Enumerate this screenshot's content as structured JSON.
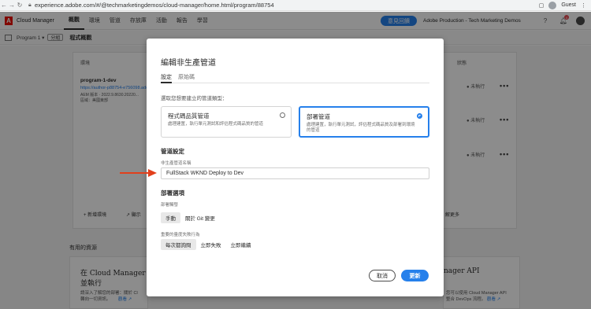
{
  "browser": {
    "url": "experience.adobe.com/#/@techmarketingdemos/cloud-manager/home.html/program/88754",
    "guest_label": "Guest",
    "menu_glyph": "⋮"
  },
  "header": {
    "app_name": "Cloud Manager",
    "nav": [
      "概觀",
      "環境",
      "管道",
      "存放庫",
      "活動",
      "報告",
      "學習"
    ],
    "cta_label": "意見回饋",
    "org_name": "Adobe Production - Tech Marketing Demos",
    "notification_count": "4"
  },
  "subheader": {
    "program_select": "Program 1 ▾",
    "share_label": "分組",
    "title": "程式概觀"
  },
  "background": {
    "col_header_left": "環境",
    "col_header_right": "狀態",
    "env_name": "program-1-dev",
    "env_link": "https://author-p88754-e756098.adob...",
    "env_meta": "AEM 版本 · 2022.9.8630.20220...",
    "env_region": "區域：美國東部",
    "status_1": "● 未執行",
    "status_2": "● 未執行",
    "status_3": "● 未執行",
    "add_env": "+ 新增環境",
    "show_more": "↗ 顯示",
    "learn_more": "解更多",
    "useful_resources": "有用的資源",
    "card_left_title_1": "在 Cloud Manager 上",
    "card_left_title_2": "並執行",
    "card_left_body_1": "請深入了解您的部署：關於 Cl",
    "card_left_body_2": "轉向一切資訊。",
    "card_left_link": "觀看 ↗",
    "card_right_title": "nager API",
    "card_right_body_1": "您可以使用 Cloud Manager API",
    "card_right_body_2": "整合 DevOps 流程。",
    "card_right_link": "觀看 ↗"
  },
  "modal": {
    "title": "編輯非生產管道",
    "tabs": [
      "設定",
      "原始碼"
    ],
    "type_caption": "選取您想要建立的管道類型：",
    "option_quality": {
      "title": "程式碼品質管道",
      "desc": "處理建置，執行單元測試和評估程式碼品質的管道"
    },
    "option_deploy": {
      "title": "部署管道",
      "desc": "處理建置，執行單元測試，評估程式碼品質及部署到環境的管道"
    },
    "pipeline_settings_heading": "管道設定",
    "name_label": "非生產管道名稱",
    "name_value": "FullStack WKND Deploy to Dev",
    "trigger_heading": "部署選項",
    "trigger_label": "部署觸發",
    "trigger_options": [
      "手動",
      "關於 Git 變更"
    ],
    "important_label": "重要的量度失敗行為",
    "important_options": [
      "每次都詢問",
      "立即失敗",
      "立即繼續"
    ],
    "cancel_label": "取消",
    "update_label": "更新"
  },
  "colors": {
    "accent": "#2680eb",
    "annotation_arrow": "#e2401c",
    "adobe_red": "#eb1000"
  }
}
